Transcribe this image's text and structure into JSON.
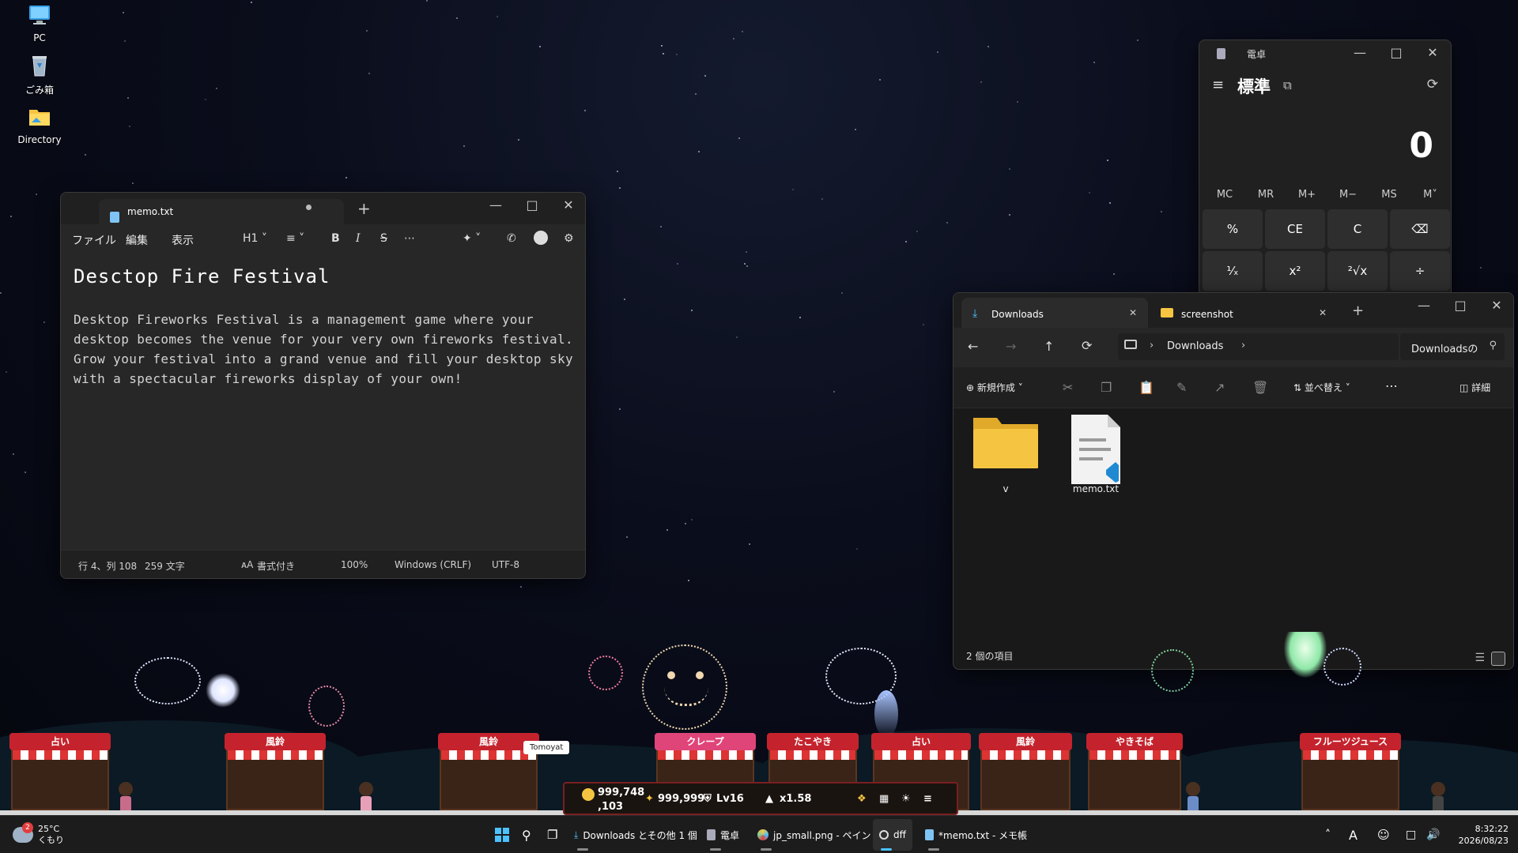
{
  "desktop": {
    "icons": [
      {
        "label": "PC",
        "icon": "monitor-icon"
      },
      {
        "label": "ごみ箱",
        "icon": "recycle-bin-icon"
      },
      {
        "label": "Directory",
        "icon": "folder-icon"
      }
    ]
  },
  "notepad": {
    "tab_title": "memo.txt",
    "menu": [
      "ファイル",
      "編集",
      "表示"
    ],
    "heading_dropdown": "H1",
    "title_line": "Desctop Fire Festival",
    "body_lines": [
      "Desktop Fireworks Festival is a management game where your",
      "desktop becomes the venue for your very own fireworks festival.",
      "Grow your festival into a grand venue and fill your desktop sky",
      "with a spectacular fireworks display of your own!"
    ],
    "status": {
      "position": "行 4、列 108",
      "chars": "259 文字",
      "format": "書式付き",
      "zoom": "100%",
      "line_ending": "Windows (CRLF)",
      "encoding": "UTF-8"
    }
  },
  "calculator": {
    "title": "電卓",
    "mode": "標準",
    "display": "0",
    "memory": [
      "MC",
      "MR",
      "M+",
      "M−",
      "MS",
      "M˅"
    ],
    "keys_row1": [
      "%",
      "CE",
      "C",
      "⌫"
    ],
    "keys_row2": [
      "¹⁄ₓ",
      "x²",
      "²√x",
      "÷"
    ]
  },
  "explorer": {
    "tabs": [
      {
        "label": "Downloads",
        "active": true
      },
      {
        "label": "screenshot",
        "active": false
      }
    ],
    "address": "Downloads",
    "search_text": "Downloadsの",
    "new_button": "新規作成",
    "sort_button": "並べ替え",
    "details_button": "詳細",
    "items": [
      {
        "name": "v",
        "type": "folder"
      },
      {
        "name": "memo.txt",
        "type": "text-file"
      }
    ],
    "status": "2 個の項目"
  },
  "festival": {
    "stalls": [
      "占い",
      "風鈴",
      "風鈴",
      "クレープ",
      "たこやき",
      "占い",
      "風鈴",
      "やきそば",
      "フルーツジュース"
    ],
    "tooltip": "Tomoyat",
    "hud": {
      "coins": "999,748",
      "coins_line2": ",103",
      "stars": "999,999",
      "level": "Lv16",
      "multiplier": "x1.58"
    }
  },
  "taskbar": {
    "weather_temp": "25°C",
    "weather_desc": "くもり",
    "weather_badge": "2",
    "apps": [
      {
        "label": "Downloads とその他 1 個",
        "icon": "download-icon"
      },
      {
        "label": "電卓",
        "icon": "calculator-icon"
      },
      {
        "label": "jp_small.png - ペイント",
        "icon": "paint-icon"
      },
      {
        "label": "dff",
        "icon": "app-icon"
      },
      {
        "label": "*memo.txt - メモ帳",
        "icon": "notepad-icon"
      }
    ],
    "ime": "A",
    "time": "8:32:22",
    "date": "2026/08/23"
  },
  "colors": {
    "accent": "#4cc2ff",
    "folder": "#f5c542",
    "stall_red": "#c4232d"
  }
}
